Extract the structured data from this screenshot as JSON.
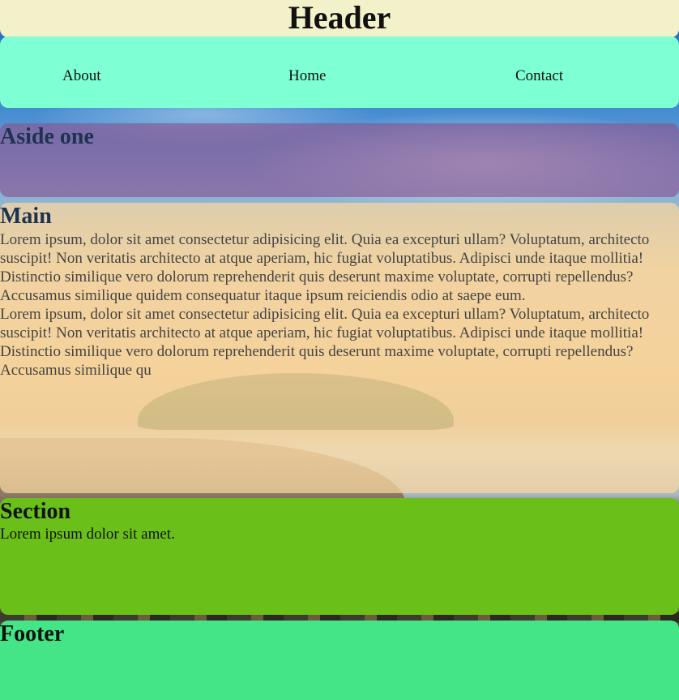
{
  "header": {
    "title": "Header"
  },
  "nav": {
    "links": [
      "About",
      "Home",
      "Contact"
    ]
  },
  "aside": {
    "title": "Aside one"
  },
  "main": {
    "title": "Main",
    "paragraphs": [
      "Lorem ipsum, dolor sit amet consectetur adipisicing elit. Quia ea excepturi ullam? Voluptatum, architecto suscipit! Non veritatis architecto at atque aperiam, hic fugiat voluptatibus. Adipisci unde itaque mollitia! Distinctio similique vero dolorum reprehenderit quis deserunt maxime voluptate, corrupti repellendus? Accusamus similique quidem consequatur itaque ipsum reiciendis odio at saepe eum.",
      "Lorem ipsum, dolor sit amet consectetur adipisicing elit. Quia ea excepturi ullam? Voluptatum, architecto suscipit! Non veritatis architecto at atque aperiam, hic fugiat voluptatibus. Adipisci unde itaque mollitia! Distinctio similique vero dolorum reprehenderit quis deserunt maxime voluptate, corrupti repellendus? Accusamus similique qu"
    ]
  },
  "section": {
    "title": "Section",
    "text": "Lorem ipsum dolor sit amet."
  },
  "footer": {
    "title": "Footer"
  },
  "colors": {
    "header_bg": "#f2f1c9",
    "nav_bg": "#7fffd4",
    "aside_bg": "#8c508c",
    "main_bg": "#fad7a0",
    "section_bg": "#6abf19",
    "footer_bg": "#43e587"
  }
}
